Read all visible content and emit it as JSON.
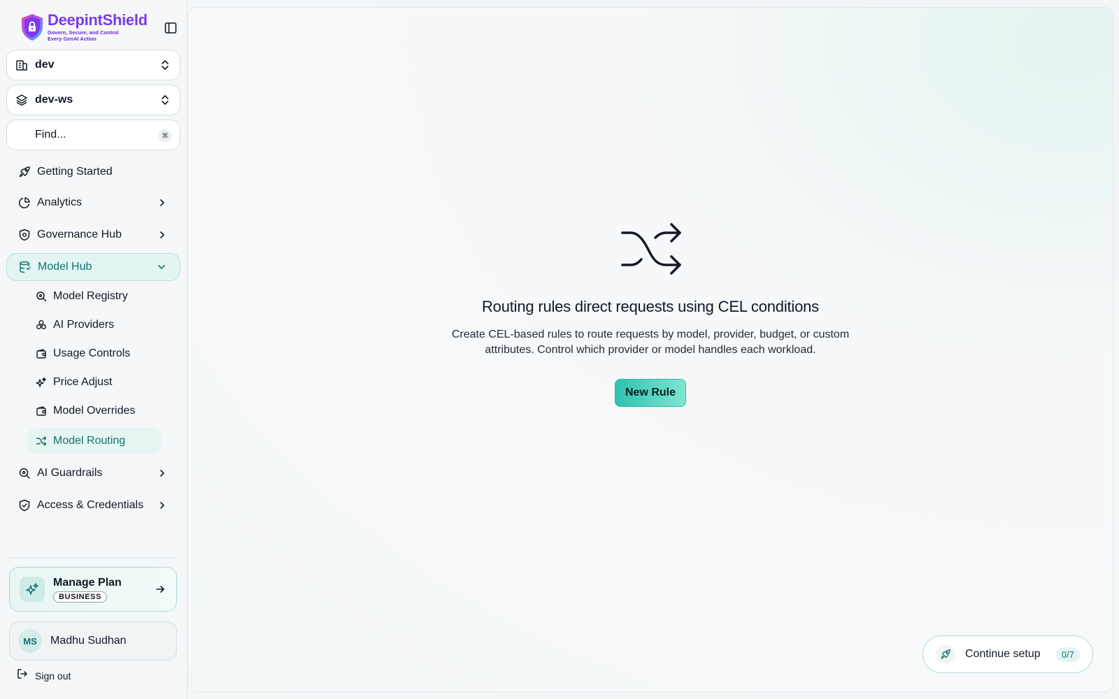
{
  "brand": {
    "name": "DeepintShield",
    "tagline_line1": "Govern, Secure, and Control",
    "tagline_line2": "Every GenAI Action"
  },
  "org_selector": {
    "value": "dev",
    "icon": "building-icon"
  },
  "workspace_selector": {
    "value": "dev-ws",
    "icon": "layers-icon"
  },
  "search": {
    "placeholder": "Find...",
    "shortcut_icon": "command-icon"
  },
  "nav": {
    "getting_started": "Getting Started",
    "analytics": "Analytics",
    "governance_hub": "Governance Hub",
    "model_hub": "Model Hub",
    "model_hub_items": [
      {
        "label": "Model Registry",
        "icon": "search-icon"
      },
      {
        "label": "AI Providers",
        "icon": "providers-icon"
      },
      {
        "label": "Usage Controls",
        "icon": "wallet-icon"
      },
      {
        "label": "Price Adjust",
        "icon": "sparkles-icon"
      },
      {
        "label": "Model Overrides",
        "icon": "wallet-icon"
      },
      {
        "label": "Model Routing",
        "icon": "shuffle-icon",
        "active": true
      }
    ],
    "ai_guardrails": "AI Guardrails",
    "access_credentials": "Access & Credentials"
  },
  "plan": {
    "title": "Manage Plan",
    "badge": "BUSINESS"
  },
  "user": {
    "initials": "MS",
    "name": "Madhu Sudhan"
  },
  "sign_out": "Sign out",
  "empty_state": {
    "icon": "shuffle-icon",
    "title": "Routing rules direct requests using CEL conditions",
    "description": "Create CEL-based rules to route requests by model, provider, budget, or custom attributes. Control which provider or model handles each workload.",
    "button": "New Rule"
  },
  "setup": {
    "label": "Continue setup",
    "progress": "0/7"
  },
  "colors": {
    "accent": "#0f766e",
    "accent_light": "#e4f4f3",
    "brand_purple": "#7c3aed",
    "button_gradient_start": "#2cc3b0",
    "button_gradient_end": "#7ee6d3"
  }
}
